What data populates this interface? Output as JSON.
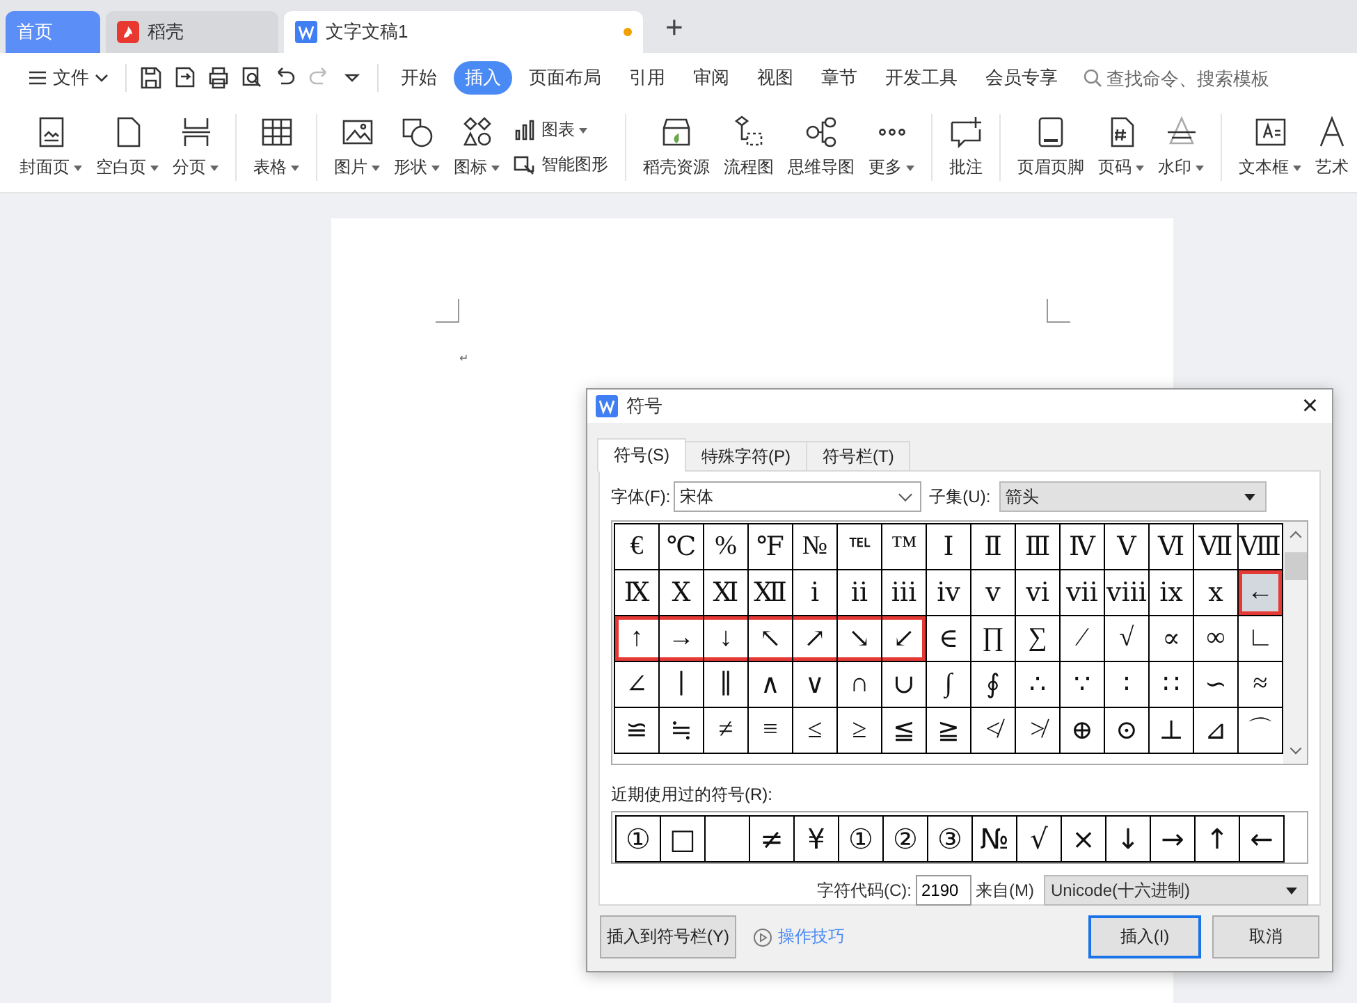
{
  "doc_tabs": [
    {
      "label": "首页",
      "kind": "home",
      "selected": false
    },
    {
      "label": "稻壳",
      "kind": "app",
      "selected": false
    },
    {
      "label": "文字文稿1",
      "kind": "doc",
      "selected": true,
      "unsaved": true
    }
  ],
  "new_tab": "+",
  "menu": {
    "file": "文件",
    "tabs": [
      {
        "label": "开始",
        "selected": false
      },
      {
        "label": "插入",
        "selected": true
      },
      {
        "label": "页面布局",
        "selected": false
      },
      {
        "label": "引用",
        "selected": false
      },
      {
        "label": "审阅",
        "selected": false
      },
      {
        "label": "视图",
        "selected": false
      },
      {
        "label": "章节",
        "selected": false
      },
      {
        "label": "开发工具",
        "selected": false
      },
      {
        "label": "会员专享",
        "selected": false
      }
    ],
    "search": {
      "placeholder": "查找命令、搜索模板"
    }
  },
  "ribbon": [
    [
      {
        "label": "封面页",
        "dropdown": true
      },
      {
        "label": "空白页",
        "dropdown": true
      },
      {
        "label": "分页",
        "dropdown": true
      }
    ],
    [
      {
        "label": "表格",
        "dropdown": true
      }
    ],
    [
      {
        "label": "图片",
        "dropdown": true
      },
      {
        "label": "形状",
        "dropdown": true
      },
      {
        "label": "图标",
        "dropdown": true
      },
      {
        "label": "图表",
        "dropdown": true,
        "kind": "small"
      },
      {
        "label": "智能图形",
        "dropdown": false,
        "kind": "small"
      }
    ],
    [
      {
        "label": "稻壳资源",
        "dropdown": false
      },
      {
        "label": "流程图",
        "dropdown": false
      },
      {
        "label": "思维导图",
        "dropdown": false
      },
      {
        "label": "更多",
        "dropdown": true
      }
    ],
    [
      {
        "label": "批注",
        "dropdown": false
      }
    ],
    [
      {
        "label": "页眉页脚",
        "dropdown": false
      },
      {
        "label": "页码",
        "dropdown": true
      },
      {
        "label": "水印",
        "dropdown": true
      }
    ],
    [
      {
        "label": "文本框",
        "dropdown": true
      },
      {
        "label": "艺术",
        "dropdown": false
      }
    ]
  ],
  "document": {
    "paragraph_mark": "↵"
  },
  "dialog": {
    "title": "符号",
    "close": "×",
    "tabs": [
      {
        "label": "符号(S)",
        "selected": true
      },
      {
        "label": "特殊字符(P)",
        "selected": false
      },
      {
        "label": "符号栏(T)",
        "selected": false
      }
    ],
    "font_label": "字体(F):",
    "font_value": "宋体",
    "subset_label": "子集(U):",
    "subset_value": "箭头",
    "grid": [
      [
        {
          "symbol": "€",
          "selected": false
        },
        {
          "symbol": "℃",
          "selected": false
        },
        {
          "symbol": "%",
          "selected": false
        },
        {
          "symbol": "℉",
          "selected": false
        },
        {
          "symbol": "№",
          "selected": false
        },
        {
          "symbol": "℡",
          "selected": false
        },
        {
          "symbol": "™",
          "selected": false
        },
        {
          "symbol": "Ⅰ",
          "selected": false
        },
        {
          "symbol": "Ⅱ",
          "selected": false
        },
        {
          "symbol": "Ⅲ",
          "selected": false
        },
        {
          "symbol": "Ⅳ",
          "selected": false
        },
        {
          "symbol": "Ⅴ",
          "selected": false
        },
        {
          "symbol": "Ⅵ",
          "selected": false
        },
        {
          "symbol": "Ⅶ",
          "selected": false
        },
        {
          "symbol": "Ⅷ",
          "selected": false
        }
      ],
      [
        {
          "symbol": "Ⅸ",
          "selected": false
        },
        {
          "symbol": "Ⅹ",
          "selected": false
        },
        {
          "symbol": "Ⅺ",
          "selected": false
        },
        {
          "symbol": "Ⅻ",
          "selected": false
        },
        {
          "symbol": "ⅰ",
          "selected": false
        },
        {
          "symbol": "ⅱ",
          "selected": false
        },
        {
          "symbol": "ⅲ",
          "selected": false
        },
        {
          "symbol": "ⅳ",
          "selected": false
        },
        {
          "symbol": "ⅴ",
          "selected": false
        },
        {
          "symbol": "ⅵ",
          "selected": false
        },
        {
          "symbol": "ⅶ",
          "selected": false
        },
        {
          "symbol": "ⅷ",
          "selected": false
        },
        {
          "symbol": "ⅸ",
          "selected": false
        },
        {
          "symbol": "ⅹ",
          "selected": false
        },
        {
          "symbol": "←",
          "selected": true,
          "boxed": true
        }
      ],
      [
        {
          "symbol": "↑",
          "selected": false,
          "boxed": true
        },
        {
          "symbol": "→",
          "selected": false,
          "boxed": true
        },
        {
          "symbol": "↓",
          "selected": false,
          "boxed": true
        },
        {
          "symbol": "↖",
          "selected": false,
          "boxed": true
        },
        {
          "symbol": "↗",
          "selected": false,
          "boxed": true
        },
        {
          "symbol": "↘",
          "selected": false,
          "boxed": true
        },
        {
          "symbol": "↙",
          "selected": false,
          "boxed": true
        },
        {
          "symbol": "∈",
          "selected": false
        },
        {
          "symbol": "∏",
          "selected": false
        },
        {
          "symbol": "∑",
          "selected": false
        },
        {
          "symbol": "∕",
          "selected": false
        },
        {
          "symbol": "√",
          "selected": false
        },
        {
          "symbol": "∝",
          "selected": false
        },
        {
          "symbol": "∞",
          "selected": false
        },
        {
          "symbol": "∟",
          "selected": false
        }
      ],
      [
        {
          "symbol": "∠",
          "selected": false
        },
        {
          "symbol": "∣",
          "selected": false
        },
        {
          "symbol": "∥",
          "selected": false
        },
        {
          "symbol": "∧",
          "selected": false
        },
        {
          "symbol": "∨",
          "selected": false
        },
        {
          "symbol": "∩",
          "selected": false
        },
        {
          "symbol": "∪",
          "selected": false
        },
        {
          "symbol": "∫",
          "selected": false
        },
        {
          "symbol": "∮",
          "selected": false
        },
        {
          "symbol": "∴",
          "selected": false
        },
        {
          "symbol": "∵",
          "selected": false
        },
        {
          "symbol": "∶",
          "selected": false
        },
        {
          "symbol": "∷",
          "selected": false
        },
        {
          "symbol": "∽",
          "selected": false
        },
        {
          "symbol": "≈",
          "selected": false
        }
      ],
      [
        {
          "symbol": "≌",
          "selected": false
        },
        {
          "symbol": "≒",
          "selected": false
        },
        {
          "symbol": "≠",
          "selected": false
        },
        {
          "symbol": "≡",
          "selected": false
        },
        {
          "symbol": "≤",
          "selected": false
        },
        {
          "symbol": "≥",
          "selected": false
        },
        {
          "symbol": "≦",
          "selected": false
        },
        {
          "symbol": "≧",
          "selected": false
        },
        {
          "symbol": "≮",
          "selected": false
        },
        {
          "symbol": "≯",
          "selected": false
        },
        {
          "symbol": "⊕",
          "selected": false
        },
        {
          "symbol": "⊙",
          "selected": false
        },
        {
          "symbol": "⊥",
          "selected": false
        },
        {
          "symbol": "⊿",
          "selected": false
        },
        {
          "symbol": "⌒",
          "selected": false
        }
      ]
    ],
    "recent_label": "近期使用过的符号(R):",
    "recent": [
      {
        "kind": "symbol",
        "symbol": "①"
      },
      {
        "kind": "symbol",
        "symbol": "□"
      },
      {
        "kind": "blank"
      },
      {
        "kind": "symbol",
        "symbol": "≠"
      },
      {
        "kind": "symbol",
        "symbol": "¥"
      },
      {
        "kind": "symbol",
        "symbol": "①"
      },
      {
        "kind": "symbol",
        "symbol": "②"
      },
      {
        "kind": "symbol",
        "symbol": "③"
      },
      {
        "kind": "symbol",
        "symbol": "№"
      },
      {
        "kind": "symbol",
        "symbol": "√"
      },
      {
        "kind": "symbol",
        "symbol": "×"
      },
      {
        "kind": "symbol",
        "symbol": "↓"
      },
      {
        "kind": "symbol",
        "symbol": "→"
      },
      {
        "kind": "symbol",
        "symbol": "↑"
      },
      {
        "kind": "symbol",
        "symbol": "←"
      }
    ],
    "code_label": "字符代码(C):",
    "code_value": "2190",
    "from_label": "来自(M)",
    "from_value": "Unicode(十六进制)",
    "add_to_bar": "插入到符号栏(Y)",
    "tips": "操作技巧",
    "insert": "插入(I)",
    "cancel": "取消"
  }
}
